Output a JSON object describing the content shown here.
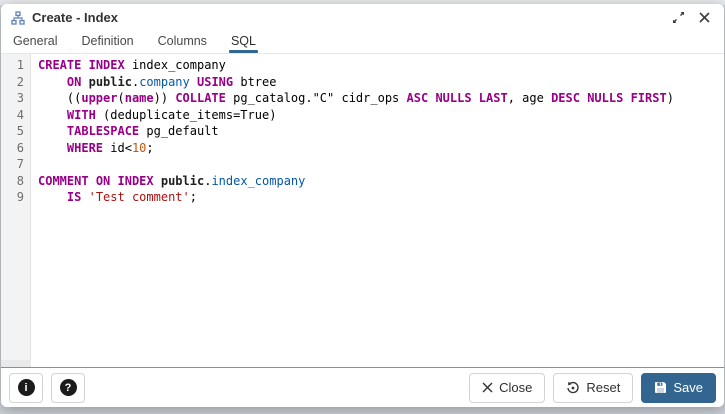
{
  "window": {
    "title": "Create - Index",
    "icon": "index-icon",
    "controls": {
      "maximize": "expand",
      "close": "close"
    }
  },
  "tabs": [
    {
      "label": "General",
      "active": false
    },
    {
      "label": "Definition",
      "active": false
    },
    {
      "label": "Columns",
      "active": false
    },
    {
      "label": "SQL",
      "active": true
    }
  ],
  "colors": {
    "accent": "#326690",
    "keyword": "#990088",
    "schema": "#1f1f1f",
    "relation": "#0558a8",
    "number": "#c4540a",
    "string": "#aa1111",
    "gutter_bg": "#f3f3f3"
  },
  "editor": {
    "language": "sql",
    "line_count": 9,
    "lines": [
      [
        {
          "t": "CREATE",
          "c": "k"
        },
        {
          "t": " ",
          "c": "p"
        },
        {
          "t": "INDEX",
          "c": "k"
        },
        {
          "t": " index_company",
          "c": "p"
        }
      ],
      [
        {
          "t": "    ",
          "c": "p"
        },
        {
          "t": "ON",
          "c": "k"
        },
        {
          "t": " ",
          "c": "p"
        },
        {
          "t": "public",
          "c": "sch"
        },
        {
          "t": ".",
          "c": "p"
        },
        {
          "t": "company",
          "c": "rel"
        },
        {
          "t": " ",
          "c": "p"
        },
        {
          "t": "USING",
          "c": "k"
        },
        {
          "t": " btree",
          "c": "p"
        }
      ],
      [
        {
          "t": "    ((",
          "c": "p"
        },
        {
          "t": "upper",
          "c": "k"
        },
        {
          "t": "(",
          "c": "p"
        },
        {
          "t": "name",
          "c": "k"
        },
        {
          "t": ")) ",
          "c": "p"
        },
        {
          "t": "COLLATE",
          "c": "k"
        },
        {
          "t": " pg_catalog.\"C\" cidr_ops ",
          "c": "p"
        },
        {
          "t": "ASC",
          "c": "k"
        },
        {
          "t": " ",
          "c": "p"
        },
        {
          "t": "NULLS",
          "c": "k"
        },
        {
          "t": " ",
          "c": "p"
        },
        {
          "t": "LAST",
          "c": "k"
        },
        {
          "t": ", age ",
          "c": "p"
        },
        {
          "t": "DESC",
          "c": "k"
        },
        {
          "t": " ",
          "c": "p"
        },
        {
          "t": "NULLS",
          "c": "k"
        },
        {
          "t": " ",
          "c": "p"
        },
        {
          "t": "FIRST",
          "c": "k"
        },
        {
          "t": ")",
          "c": "p"
        }
      ],
      [
        {
          "t": "    ",
          "c": "p"
        },
        {
          "t": "WITH",
          "c": "k"
        },
        {
          "t": " (deduplicate_items=True)",
          "c": "p"
        }
      ],
      [
        {
          "t": "    ",
          "c": "p"
        },
        {
          "t": "TABLESPACE",
          "c": "k"
        },
        {
          "t": " pg_default",
          "c": "p"
        }
      ],
      [
        {
          "t": "    ",
          "c": "p"
        },
        {
          "t": "WHERE",
          "c": "k"
        },
        {
          "t": " id<",
          "c": "p"
        },
        {
          "t": "10",
          "c": "n"
        },
        {
          "t": ";",
          "c": "p"
        }
      ],
      [],
      [
        {
          "t": "COMMENT",
          "c": "k"
        },
        {
          "t": " ",
          "c": "p"
        },
        {
          "t": "ON",
          "c": "k"
        },
        {
          "t": " ",
          "c": "p"
        },
        {
          "t": "INDEX",
          "c": "k"
        },
        {
          "t": " ",
          "c": "p"
        },
        {
          "t": "public",
          "c": "sch"
        },
        {
          "t": ".",
          "c": "p"
        },
        {
          "t": "index_company",
          "c": "rel"
        }
      ],
      [
        {
          "t": "    ",
          "c": "p"
        },
        {
          "t": "IS",
          "c": "k"
        },
        {
          "t": " ",
          "c": "p"
        },
        {
          "t": "'Test comment'",
          "c": "s"
        },
        {
          "t": ";",
          "c": "p"
        }
      ]
    ]
  },
  "footer": {
    "info_glyph": "i",
    "help_glyph": "?",
    "close_label": "Close",
    "reset_label": "Reset",
    "save_label": "Save"
  }
}
